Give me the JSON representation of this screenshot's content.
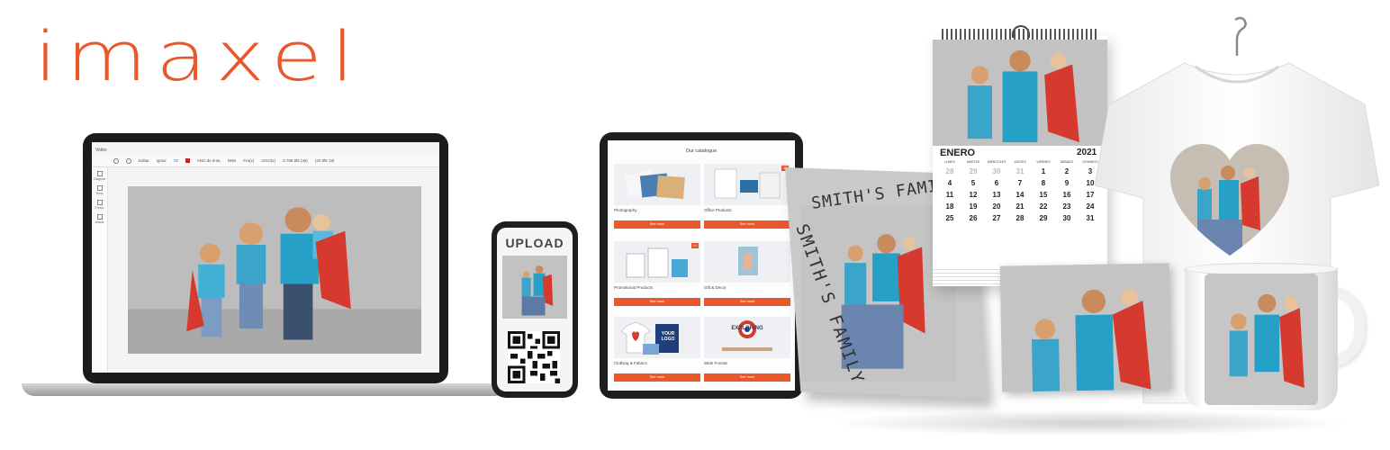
{
  "brand": {
    "logo_text": "imaxel",
    "accent": "#e8582a"
  },
  "laptop_editor": {
    "window_title": "Vidéo",
    "toolbar": [
      "Editar",
      "Ignaz",
      "72",
      "ANO de tinta",
      "NNN",
      "Fra(x)",
      "OGO(x)",
      "0.798 Ø5 (36)",
      "(20 Ø5 19)"
    ],
    "sidebar": [
      "Diagrsal",
      "Texto",
      "Fondo",
      "Añadir"
    ]
  },
  "phone": {
    "title": "UPLOAD"
  },
  "tablet": {
    "catalog_title": "Our catalogue",
    "button_label": "See more",
    "items": [
      {
        "label": "Photography",
        "badge": ""
      },
      {
        "label": "Office Products",
        "badge": "12"
      },
      {
        "label": "Promotional Products",
        "badge": "1+"
      },
      {
        "label": "Gift & Decor",
        "badge": ""
      },
      {
        "label": "Clothing & Fabrics",
        "badge": ""
      },
      {
        "label": "Wide Format",
        "badge": ""
      }
    ],
    "item_texts": {
      "your_logo": "YOUR LOGO",
      "exploring": "EXPLORING"
    }
  },
  "photobook": {
    "cover_title": "SMITH'S FAMILY",
    "spine_title": "SMITH'S FAMILY"
  },
  "calendar": {
    "month": "ENERO",
    "year": "2021",
    "weekdays": [
      "LUNES",
      "MARTES",
      "MIÉRCOLES",
      "JUEVES",
      "VIERNES",
      "SÁBADO",
      "DOMINGO"
    ],
    "days": [
      "28",
      "29",
      "30",
      "31",
      "1",
      "2",
      "3",
      "4",
      "5",
      "6",
      "7",
      "8",
      "9",
      "10",
      "11",
      "12",
      "13",
      "14",
      "15",
      "16",
      "17",
      "18",
      "19",
      "20",
      "21",
      "22",
      "23",
      "24",
      "25",
      "26",
      "27",
      "28",
      "29",
      "30",
      "31"
    ],
    "muted_count": 4
  }
}
